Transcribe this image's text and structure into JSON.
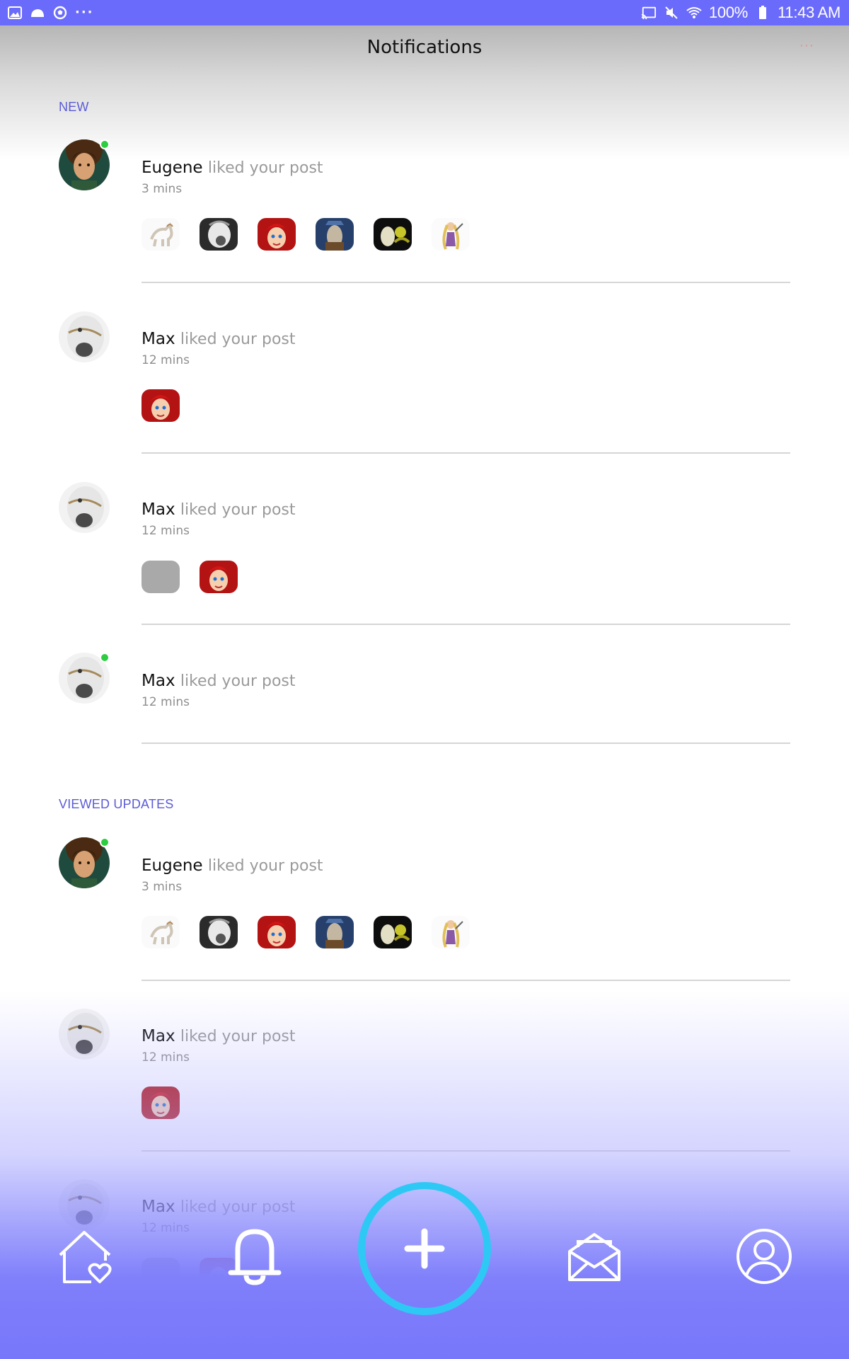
{
  "status_bar": {
    "battery": "100%",
    "time": "11:43 AM",
    "left_icons": [
      "image-icon",
      "cloud-icon",
      "soccer-icon",
      "more-dots-icon"
    ],
    "right_icons": [
      "cast-icon",
      "mute-icon",
      "wifi-icon",
      "battery-icon"
    ]
  },
  "header": {
    "title": "Notifications",
    "more_label": "···"
  },
  "sections": {
    "new_label": "NEW",
    "viewed_label": "VIEWED UPDATES"
  },
  "notifications": [
    {
      "user": "Eugene",
      "action": "liked your post",
      "time": "3 mins",
      "online": true
    },
    {
      "user": "Max",
      "action": "liked your post",
      "time": "12 mins",
      "online": false
    },
    {
      "user": "Max",
      "action": "liked your post",
      "time": "12 mins",
      "online": false
    },
    {
      "user": "Max",
      "action": "liked your post",
      "time": "12 mins",
      "online": true
    },
    {
      "user": "Eugene",
      "action": "liked your post",
      "time": "3 mins",
      "online": true
    },
    {
      "user": "Max",
      "action": "liked your post",
      "time": "12 mins",
      "online": false
    },
    {
      "user": "Max",
      "action": "liked your post",
      "time": "12 mins",
      "online": false
    }
  ],
  "nav": {
    "items": [
      "home-heart-icon",
      "bell-icon",
      "add-post-icon",
      "mail-open-icon",
      "profile-icon"
    ],
    "active": "bell-icon",
    "fab_color": "#2ec8f5",
    "accent": "#6b6bfb"
  }
}
